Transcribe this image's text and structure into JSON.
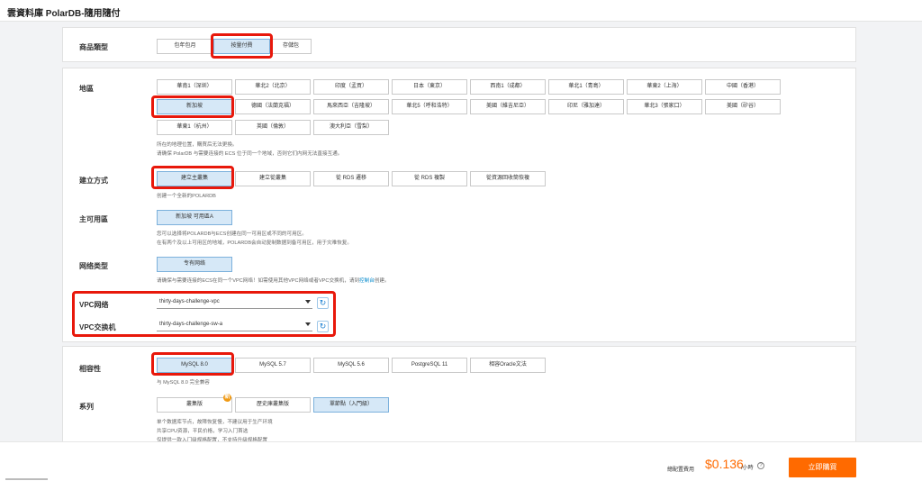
{
  "header": {
    "title": "雲資料庫 PolarDB-隨用隨付"
  },
  "product_type": {
    "label": "商品類型",
    "options": [
      "包年包月",
      "按量付費",
      "存儲包"
    ]
  },
  "region": {
    "label": "地區",
    "options": [
      "華南1（深圳）",
      "華北2（北京）",
      "印度（孟買）",
      "日本（東京）",
      "西南1（成都）",
      "華北1（青島）",
      "華東2（上海）",
      "中國（香港）",
      "新加坡",
      "德國（法蘭克福）",
      "馬來西亞（吉隆坡）",
      "華北5（呼和浩特）",
      "美國（維吉尼亞）",
      "印尼（雅加達）",
      "華北3（張家口）",
      "美國（矽谷）",
      "華東1（杭州）",
      "英國（倫敦）",
      "澳大利亞（雪梨）"
    ],
    "hint1": "所在的地理位置，購買后无法更換。",
    "hint2": "请确保 PolarDB 与需要连接的 ECS 位于同一个地域，否则它们内网无法直接互通。"
  },
  "create_method": {
    "label": "建立方式",
    "options": [
      "建立主叢集",
      "建立從叢集",
      "從 RDS 遷移",
      "從 RDS 複製",
      "從資源回收筒恢複"
    ],
    "hint": "创建一个全新的POLARDB"
  },
  "primary_zone": {
    "label": "主可用區",
    "option": "新加坡 可用區A",
    "hint1": "您可以选择将POLARDB与ECS创建在同一可用区或不同的可用区。",
    "hint2": "在有两个及以上可用区的地域，POLARDB会自动复制数据到备可用区，用于灾难恢复。"
  },
  "network_type": {
    "label": "网络类型",
    "option": "专有网络",
    "hint_pre": "请确保与需要连接的ECS在同一个VPC网络！如需使用其他VPC网络或者VPC交换机，请到",
    "hint_link": "控制台",
    "hint_post": "创建。"
  },
  "vpc": {
    "label": "VPC网络",
    "value": "thirty-days-challenge-vpc"
  },
  "vswitch": {
    "label": "VPC交换机",
    "value": "thirty-days-challenge-sw-a"
  },
  "compat": {
    "label": "相容性",
    "options": [
      "MySQL 8.0",
      "MySQL 5.7",
      "MySQL 5.6",
      "PostgreSQL 11",
      "相容Oracle文法"
    ],
    "hint": "与 MySQL 8.0 完全兼容"
  },
  "series": {
    "label": "系列",
    "options": [
      "叢集版",
      "歷史庫叢集版",
      "單節點（入門級）"
    ],
    "hint1": "单个数据库节点，故障恢复慢，不建议用于生产环境",
    "hint2": "共享CPU资源，平民价格，学习入门首选",
    "hint3": "仅提供一款入门级规格配置，不支持升级规格配置"
  },
  "footer": {
    "label": "總配置費用",
    "price": "$0.136",
    "unit": "/小時",
    "help": "?",
    "buy": "立即購買"
  },
  "icons": {
    "refresh": "refresh-icon",
    "badge": "new-badge-icon"
  },
  "colors": {
    "accent": "#ff6a00",
    "highlight": "#e8180b",
    "selected_bg": "#d6e8f7"
  }
}
